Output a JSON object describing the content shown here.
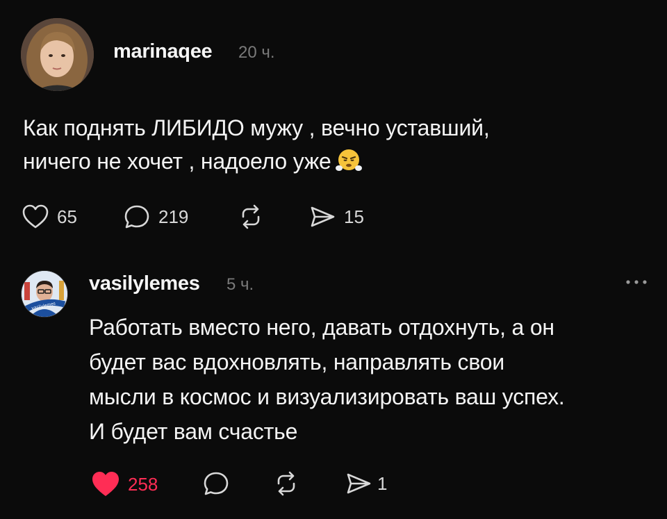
{
  "post": {
    "username": "marinaqee",
    "time": "20 ч.",
    "text_line1": "Как поднять ЛИБИДО мужу , вечно уставший,",
    "text_line2": "ничего не хочет , надоело уже",
    "emoji": "face-with-steam-from-nose",
    "likes": "65",
    "replies": "219",
    "shares": "15"
  },
  "comment": {
    "username": "vasilylemes",
    "time": "5 ч.",
    "avatar_badge": "vasilylemes",
    "text_line1": "Работать вместо него, давать отдохнуть, а он",
    "text_line2": "будет вас вдохновлять, направлять свои",
    "text_line3": "мысли в космос и визуализировать ваш успех.",
    "text_line4": "И будет вам счастье",
    "likes": "258",
    "liked": true,
    "shares": "1"
  },
  "colors": {
    "background": "#0b0b0b",
    "like_active": "#ff2d55",
    "muted": "#7a7a7a"
  }
}
